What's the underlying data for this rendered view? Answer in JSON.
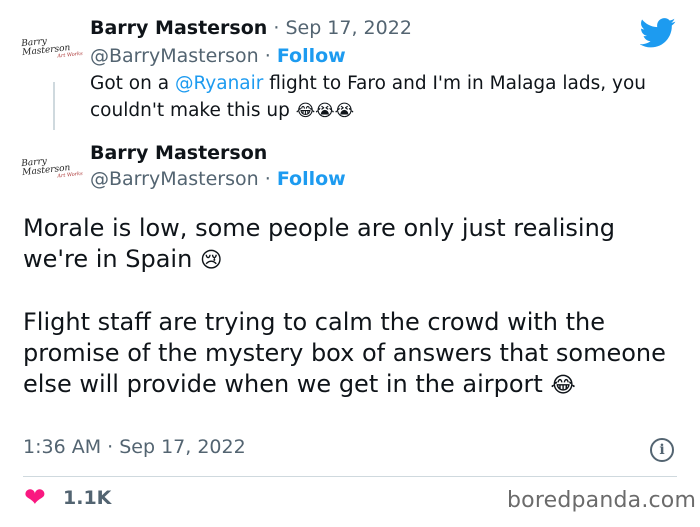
{
  "quoted_tweet": {
    "author_name": "Barry Masterson",
    "separator": "·",
    "date": "Sep 17, 2022",
    "handle": "@BarryMasterson",
    "follow_label": "Follow",
    "text_before": "Got on a ",
    "mention": "@Ryanair",
    "text_after": " flight to Faro and I'm in Malaga lads, you couldn't make this up ",
    "emojis": "😂😭😭"
  },
  "main_tweet": {
    "author_name": "Barry Masterson",
    "handle": "@BarryMasterson",
    "separator": "·",
    "follow_label": "Follow",
    "paragraph_1": "Morale is low, some people are only just realising we're in Spain ",
    "paragraph_1_emoji": "😢",
    "paragraph_2": "Flight staff are trying to calm the crowd with the promise of the mystery box of answers that someone else will provide when we get in the airport ",
    "paragraph_2_emoji": "😂",
    "timestamp": "1:36 AM · Sep 17, 2022",
    "likes_count": "1.1K"
  },
  "avatar_signature": "Barry Masterson",
  "avatar_subtext": "Art Works",
  "icons": {
    "brand": "twitter-bird-icon",
    "info": "info-icon",
    "like": "heart-icon"
  },
  "colors": {
    "accent": "#1d9bf0",
    "heart": "#f91880",
    "muted": "#536471"
  },
  "watermark": "boredpanda.com"
}
